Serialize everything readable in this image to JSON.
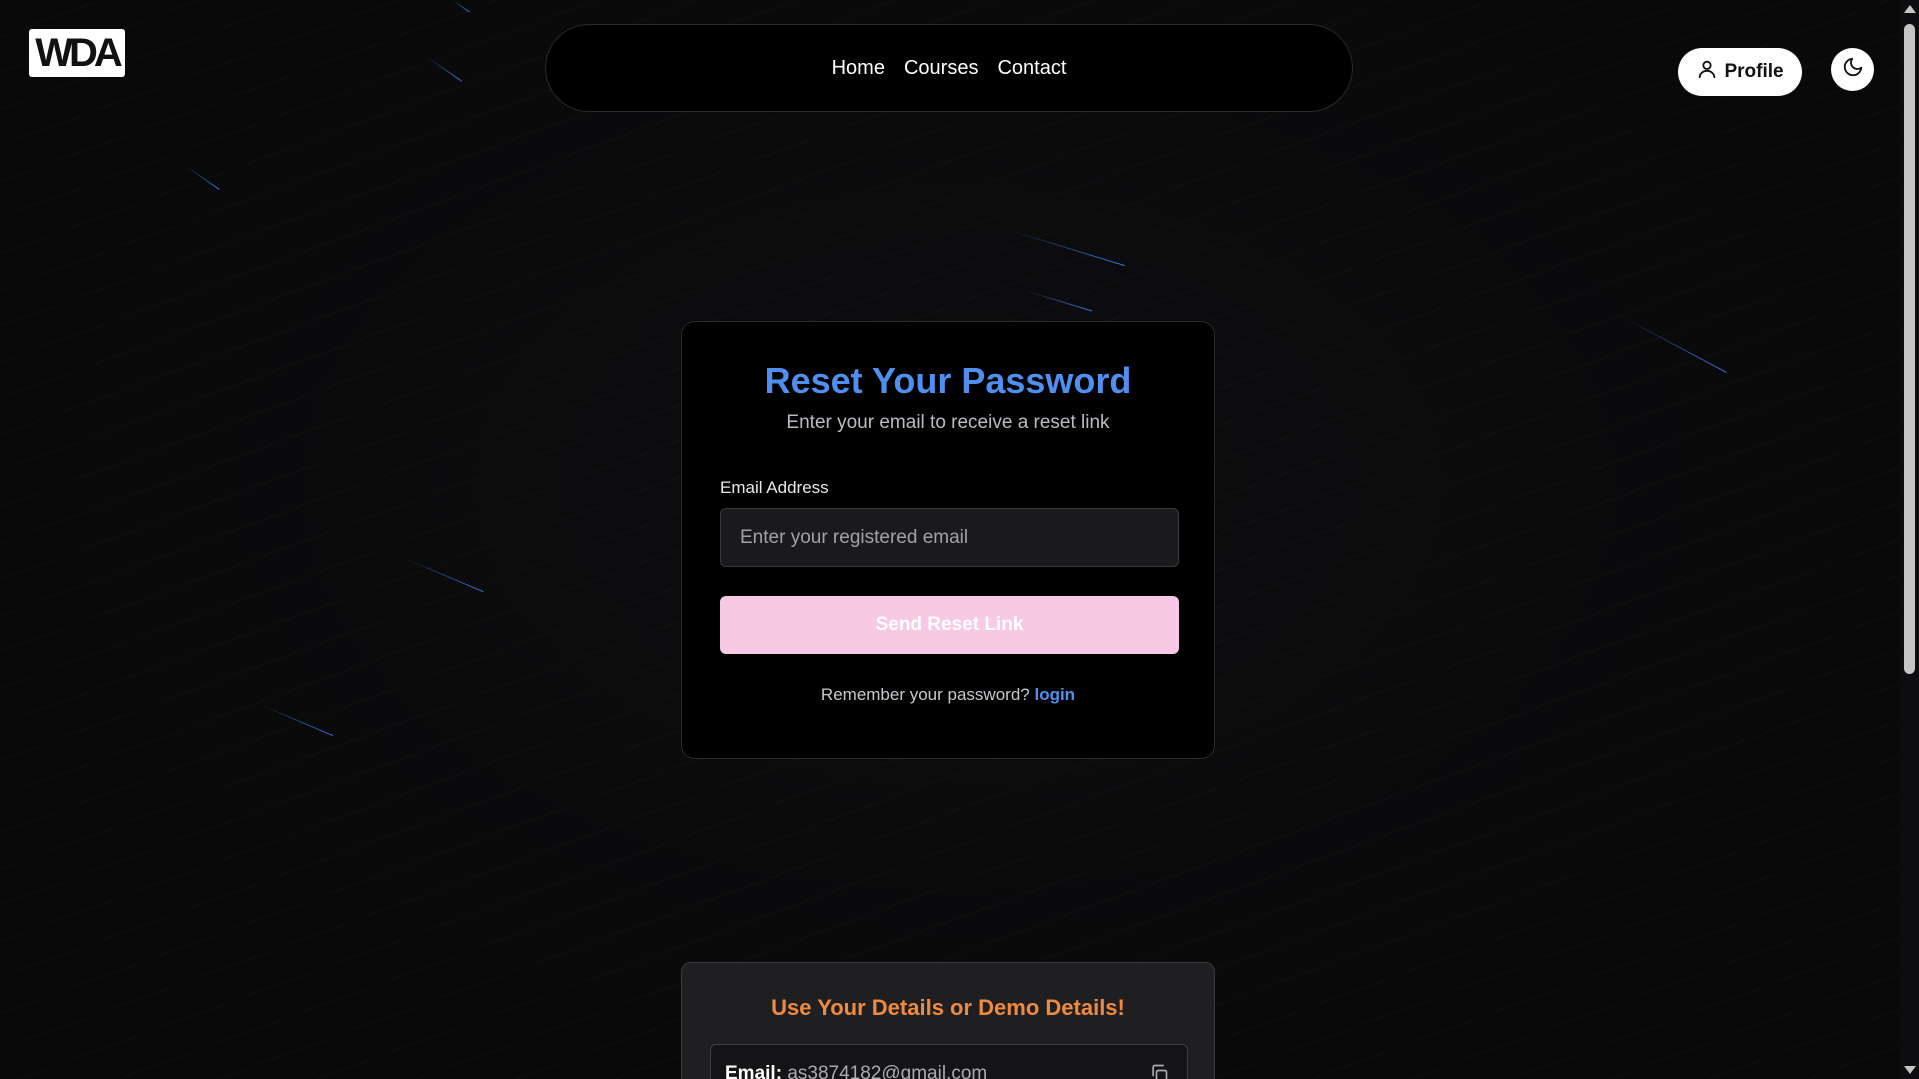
{
  "logo": {
    "text": "WDA"
  },
  "nav": {
    "items": [
      {
        "label": "Home"
      },
      {
        "label": "Courses"
      },
      {
        "label": "Contact"
      }
    ]
  },
  "header": {
    "profile_label": "Profile"
  },
  "reset_card": {
    "title": "Reset Your Password",
    "subtitle": "Enter your email to receive a reset link",
    "email_label": "Email Address",
    "email_placeholder": "Enter your registered email",
    "email_value": "",
    "submit_label": "Send Reset Link",
    "remember_text": "Remember your password?",
    "login_link": "login"
  },
  "demo_card": {
    "title": "Use Your Details or Demo Details!",
    "email_key": "Email:",
    "email_value": "as3874182@gmail.com"
  },
  "colors": {
    "accent_blue": "#4f8ff0",
    "button_pink": "#f7c9e4",
    "demo_orange": "#f08a3c"
  },
  "icons": [
    "user-icon",
    "moon-icon",
    "copy-icon"
  ]
}
